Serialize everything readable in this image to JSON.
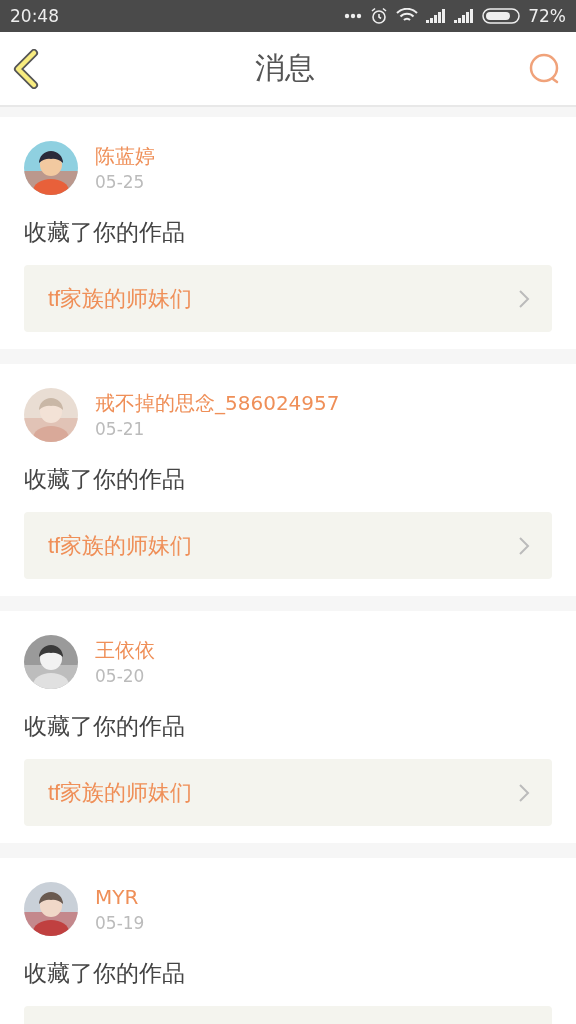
{
  "status_bar": {
    "time": "20:48",
    "battery": "72%"
  },
  "header": {
    "title": "消息"
  },
  "messages": [
    {
      "user": "陈蓝婷",
      "date": "05-25",
      "action": "收藏了你的作品",
      "link": "tf家族的师妹们"
    },
    {
      "user": "戒不掉的思念_586024957",
      "date": "05-21",
      "action": "收藏了你的作品",
      "link": "tf家族的师妹们"
    },
    {
      "user": "王依依",
      "date": "05-20",
      "action": "收藏了你的作品",
      "link": "tf家族的师妹们"
    },
    {
      "user": "MYR",
      "date": "05-19",
      "action": "收藏了你的作品"
    }
  ]
}
